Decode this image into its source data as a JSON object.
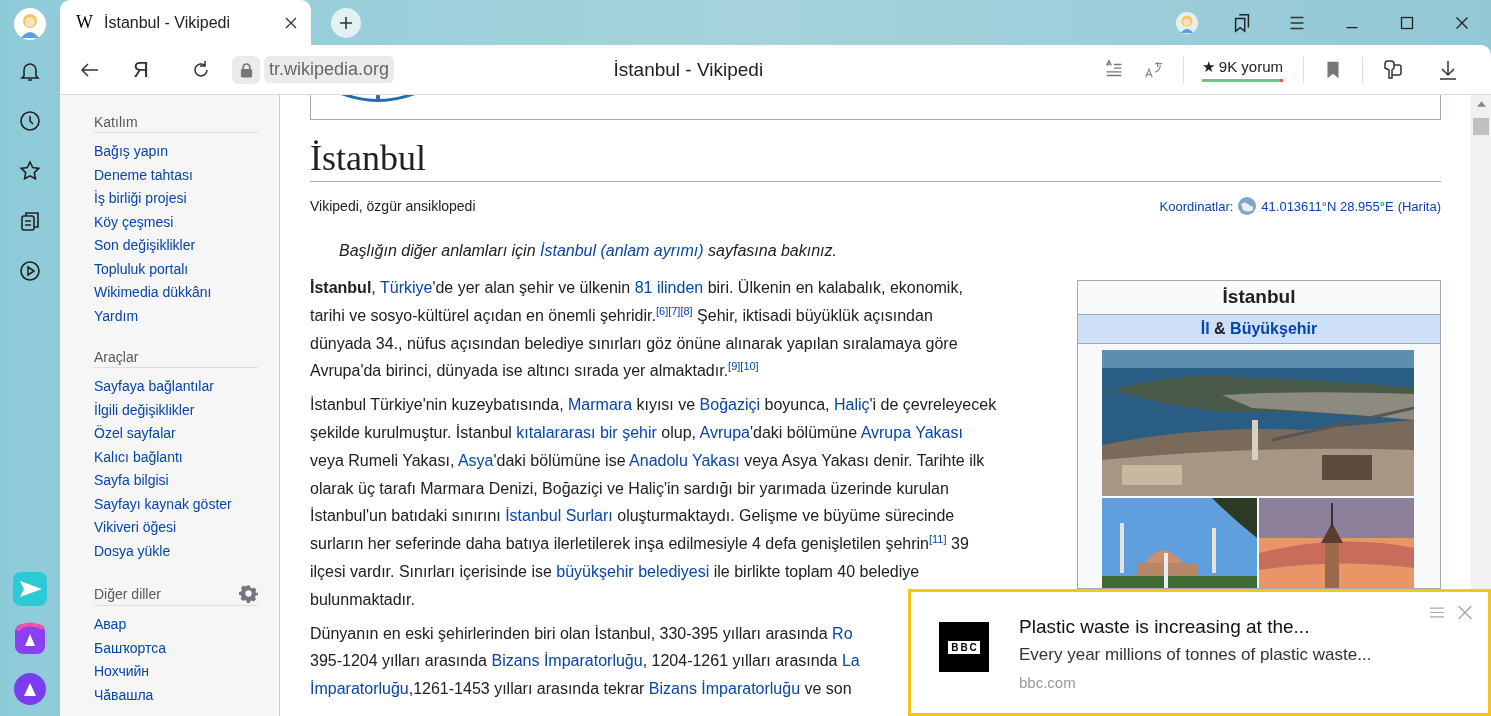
{
  "browser": {
    "tabs": [
      {
        "favicon": "W",
        "title": "İstanbul - Vikipedi",
        "selected": true
      }
    ],
    "home_button": "Я",
    "url": "tr.wikipedia.org",
    "page_title": "İstanbul - Vikipedi",
    "reviews": {
      "label": "★ 9K yorum",
      "level": 0.96
    }
  },
  "wiki_sidebar": {
    "sections": [
      {
        "heading": "Katılım",
        "settings": false,
        "links": [
          "Bağış yapın",
          "Deneme tahtası",
          "İş birliği projesi",
          "Köy çeşmesi",
          "Son değişiklikler",
          "Topluluk portalı",
          "Wikimedia dükkânı",
          "Yardım"
        ]
      },
      {
        "heading": "Araçlar",
        "settings": false,
        "links": [
          "Sayfaya bağlantılar",
          "İlgili değişiklikler",
          "Özel sayfalar",
          "Kalıcı bağlantı",
          "Sayfa bilgisi",
          "Sayfayı kaynak göster",
          "Vikiveri öğesi",
          "Dosya yükle"
        ]
      },
      {
        "heading": "Diğer diller",
        "settings": true,
        "links": [
          "Авар",
          "Башҡортса",
          "Нохчийн",
          "Чӑвашла"
        ]
      }
    ]
  },
  "article": {
    "title": "İstanbul",
    "tagline": "Vikipedi, özgür ansiklopedi",
    "coordinates": {
      "label": "Koordinatlar:",
      "value": "41.013611°N 28.955°E",
      "map_link": "(Harita)"
    },
    "hatnote": [
      {
        "kind": "text",
        "text": "Başlığın diğer anlamları için "
      },
      {
        "kind": "link",
        "text": "İstanbul (anlam ayrımı)"
      },
      {
        "kind": "text",
        "text": " sayfasına bakınız."
      }
    ],
    "paragraphs": [
      {
        "lines": [
          [
            {
              "kind": "bold",
              "text": "İstanbul"
            },
            {
              "kind": "text",
              "text": ", "
            },
            {
              "kind": "link",
              "text": "Türkiye"
            },
            {
              "kind": "text",
              "text": "'de yer alan şehir ve ülkenin "
            },
            {
              "kind": "link",
              "text": "81 ilinden"
            },
            {
              "kind": "text",
              "text": " biri. Ülkenin en kalabalık, ekonomik,"
            }
          ],
          [
            {
              "kind": "text",
              "text": "tarihi ve sosyo-kültürel açıdan en önemli şehridir."
            },
            {
              "kind": "ref",
              "text": "[6]"
            },
            {
              "kind": "ref",
              "text": "[7]"
            },
            {
              "kind": "ref",
              "text": "[8]"
            },
            {
              "kind": "text",
              "text": " Şehir, iktisadi büyüklük açısından"
            }
          ],
          [
            {
              "kind": "text",
              "text": "dünyada 34., nüfus açısından belediye sınırları göz önüne alınarak yapılan sıralamaya göre"
            }
          ],
          [
            {
              "kind": "text",
              "text": "Avrupa'da birinci, dünyada ise altıncı sırada yer almaktadır."
            },
            {
              "kind": "ref",
              "text": "[9]"
            },
            {
              "kind": "ref",
              "text": "[10]"
            }
          ]
        ]
      },
      {
        "lines": [
          [
            {
              "kind": "text",
              "text": "İstanbul Türkiye'nin kuzeybatısında, "
            },
            {
              "kind": "link",
              "text": "Marmara"
            },
            {
              "kind": "text",
              "text": " kıyısı ve "
            },
            {
              "kind": "link",
              "text": "Boğaziçi"
            },
            {
              "kind": "text",
              "text": " boyunca, "
            },
            {
              "kind": "link",
              "text": "Haliç"
            },
            {
              "kind": "text",
              "text": "'i de çevreleyecek"
            }
          ],
          [
            {
              "kind": "text",
              "text": "şekilde kurulmuştur. İstanbul "
            },
            {
              "kind": "link",
              "text": "kıtalararası bir şehir"
            },
            {
              "kind": "text",
              "text": " olup, "
            },
            {
              "kind": "link",
              "text": "Avrupa"
            },
            {
              "kind": "text",
              "text": "'daki bölümüne "
            },
            {
              "kind": "link",
              "text": "Avrupa Yakası"
            }
          ],
          [
            {
              "kind": "text",
              "text": "veya Rumeli Yakası, "
            },
            {
              "kind": "link",
              "text": "Asya"
            },
            {
              "kind": "text",
              "text": "'daki bölümüne ise "
            },
            {
              "kind": "link",
              "text": "Anadolu Yakası"
            },
            {
              "kind": "text",
              "text": " veya Asya Yakası denir. Tarihte ilk"
            }
          ],
          [
            {
              "kind": "text",
              "text": "olarak üç tarafı Marmara Denizi, Boğaziçi ve Haliç'in sardığı bir yarımada üzerinde kurulan"
            }
          ],
          [
            {
              "kind": "text",
              "text": "İstanbul'un batıdaki sınırını "
            },
            {
              "kind": "link",
              "text": "İstanbul Surları"
            },
            {
              "kind": "text",
              "text": " oluşturmaktaydı. Gelişme ve büyüme sürecinde"
            }
          ],
          [
            {
              "kind": "text",
              "text": "surların her seferinde daha batıya ilerletilerek inşa edilmesiyle 4 defa genişletilen şehrin"
            },
            {
              "kind": "ref",
              "text": "[11]"
            },
            {
              "kind": "text",
              "text": " 39"
            }
          ],
          [
            {
              "kind": "text",
              "text": "ilçesi vardır. Sınırları içerisinde ise "
            },
            {
              "kind": "link",
              "text": "büyükşehir belediyesi"
            },
            {
              "kind": "text",
              "text": " ile birlikte toplam 40 belediye"
            }
          ],
          [
            {
              "kind": "text",
              "text": "bulunmaktadır."
            }
          ]
        ]
      },
      {
        "lines": [
          [
            {
              "kind": "text",
              "text": "Dünyanın en eski şehirlerinden biri olan İstanbul, 330-395 yılları arasında "
            },
            {
              "kind": "link",
              "text": "Ro"
            }
          ],
          [
            {
              "kind": "text",
              "text": "395-1204 yılları arasında "
            },
            {
              "kind": "link",
              "text": "Bizans İmparatorluğu"
            },
            {
              "kind": "text",
              "text": ", 1204-1261 yılları arasında "
            },
            {
              "kind": "link",
              "text": "La"
            }
          ],
          [
            {
              "kind": "link",
              "text": "İmparatorluğu"
            },
            {
              "kind": "text",
              "text": ",1261-1453 yılları arasında tekrar "
            },
            {
              "kind": "link",
              "text": "Bizans İmparatorluğu"
            },
            {
              "kind": "text",
              "text": " ve son"
            }
          ]
        ]
      }
    ],
    "infobox": {
      "title": "İstanbul",
      "subtitle": [
        {
          "kind": "link",
          "text": "İl"
        },
        {
          "kind": "text",
          "text": " & "
        },
        {
          "kind": "link",
          "text": "Büyükşehir"
        }
      ]
    }
  },
  "notification": {
    "logo": "BBC",
    "title": "Plastic waste is increasing at the...",
    "body": "Every year millions of tonnes of plastic waste...",
    "source": "bbc.com"
  }
}
